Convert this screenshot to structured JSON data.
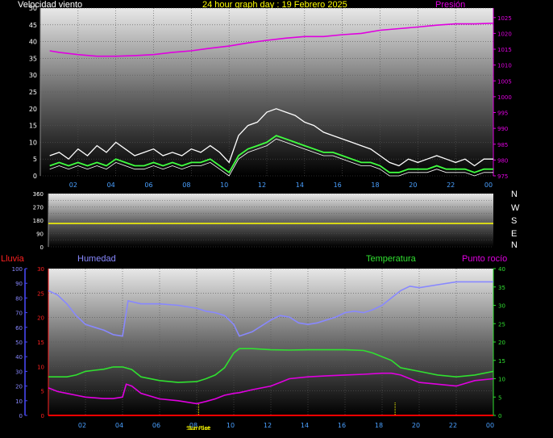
{
  "header": {
    "wind_title": "Velocidad viento",
    "graph_title": "24 hour graph day : 19 Febrero 2025",
    "pressure_title": "Presión"
  },
  "compass": [
    "N",
    "W",
    "S",
    "E",
    "N"
  ],
  "labels_bottom": {
    "rain": "Lluvia",
    "humidity": "Humedad",
    "temperature": "Temperatura",
    "dewpoint": "Punto rocío",
    "sunrise": "Sun Rise",
    "sunset": "Sun Set"
  },
  "colors": {
    "wind_gust": "#ffffff",
    "wind_avg": "#40ff40",
    "wind_avg2": "#ffffff",
    "pressure": "#e000e0",
    "direction": "#ffff00",
    "humidity": "#8888ff",
    "temperature": "#30e030",
    "dewpoint": "#e000e0",
    "rain": "#ff0000",
    "sun_marker": "#ffff00"
  },
  "chart_data": [
    {
      "type": "line",
      "name": "wind-pressure",
      "x_ticks": [
        "02",
        "04",
        "06",
        "08",
        "10",
        "12",
        "14",
        "16",
        "18",
        "20",
        "22",
        "00"
      ],
      "x_tick_hours": [
        2,
        4,
        6,
        8,
        10,
        12,
        14,
        16,
        18,
        20,
        22,
        24
      ],
      "ylim_left": [
        0,
        50
      ],
      "y_ticks_left": [
        0,
        5,
        10,
        15,
        20,
        25,
        30,
        35,
        40,
        45,
        50
      ],
      "ylim_right": [
        975,
        1028
      ],
      "y_ticks_right": [
        975,
        980,
        985,
        990,
        995,
        1000,
        1005,
        1010,
        1015,
        1020,
        1025
      ],
      "series": [
        {
          "key": "pressure",
          "axis": "right",
          "x": [
            0.5,
            1,
            2,
            3,
            4,
            5,
            6,
            7,
            8,
            9,
            10,
            11,
            12,
            13,
            14,
            15,
            16,
            17,
            18,
            19,
            20,
            21,
            22,
            23,
            24
          ],
          "values": [
            1014.5,
            1014,
            1013.3,
            1012.8,
            1012.8,
            1013,
            1013.3,
            1014,
            1014.5,
            1015.3,
            1016,
            1017,
            1017.8,
            1018.5,
            1019,
            1019,
            1019.6,
            1020,
            1021,
            1021.5,
            1022,
            1022.6,
            1023,
            1023,
            1023.2
          ]
        },
        {
          "key": "wind_gust",
          "axis": "left",
          "x": [
            0.5,
            1,
            1.5,
            2,
            2.5,
            3,
            3.5,
            4,
            4.5,
            5,
            5.5,
            6,
            6.5,
            7,
            7.5,
            8,
            8.5,
            9,
            9.5,
            10,
            10.5,
            11,
            11.5,
            12,
            12.5,
            13,
            13.5,
            14,
            14.5,
            15,
            15.5,
            16,
            16.5,
            17,
            17.5,
            18,
            18.5,
            19,
            19.5,
            20,
            20.5,
            21,
            21.5,
            22,
            22.5,
            23,
            23.5,
            24
          ],
          "values": [
            6,
            7,
            5,
            8,
            6,
            9,
            7,
            10,
            8,
            6,
            7,
            8,
            6,
            7,
            6,
            8,
            7,
            9,
            7,
            4,
            12,
            15,
            16,
            19,
            20,
            19,
            18,
            16,
            15,
            13,
            12,
            11,
            10,
            9,
            8,
            6,
            4,
            3,
            5,
            4,
            5,
            6,
            5,
            4,
            5,
            3,
            5,
            5
          ]
        },
        {
          "key": "wind_avg",
          "axis": "left",
          "x": [
            0.5,
            1,
            1.5,
            2,
            2.5,
            3,
            3.5,
            4,
            4.5,
            5,
            5.5,
            6,
            6.5,
            7,
            7.5,
            8,
            8.5,
            9,
            9.5,
            10,
            10.5,
            11,
            11.5,
            12,
            12.5,
            13,
            13.5,
            14,
            14.5,
            15,
            15.5,
            16,
            16.5,
            17,
            17.5,
            18,
            18.5,
            19,
            19.5,
            20,
            20.5,
            21,
            21.5,
            22,
            22.5,
            23,
            23.5,
            24
          ],
          "values": [
            3,
            4,
            3,
            4,
            3,
            4,
            3,
            5,
            4,
            3,
            3,
            4,
            3,
            4,
            3,
            4,
            4,
            5,
            3,
            1,
            6,
            8,
            9,
            10,
            12,
            11,
            10,
            9,
            8,
            7,
            7,
            6,
            5,
            4,
            4,
            3,
            1,
            1,
            2,
            2,
            2,
            3,
            2,
            2,
            2,
            1,
            2,
            2
          ]
        }
      ]
    },
    {
      "type": "line",
      "name": "wind-direction",
      "ylim": [
        0,
        360
      ],
      "y_ticks": [
        0,
        90,
        180,
        270,
        360
      ],
      "y_tick_labels": [
        "0",
        "90",
        "180",
        "270",
        "360"
      ],
      "extra_ticks": [
        45,
        135,
        225,
        315
      ],
      "series": [
        {
          "key": "direction",
          "x": [
            0,
            24
          ],
          "values": [
            158,
            158
          ]
        }
      ]
    },
    {
      "type": "line",
      "name": "humidity-temperature-dewpoint-rain",
      "x_ticks": [
        "02",
        "04",
        "06",
        "08",
        "10",
        "12",
        "14",
        "16",
        "18",
        "20",
        "22",
        "00"
      ],
      "x_tick_hours": [
        2,
        4,
        6,
        8,
        10,
        12,
        14,
        16,
        18,
        20,
        22,
        24
      ],
      "ylim_humidity": [
        0,
        100
      ],
      "y_ticks_humidity": [
        0,
        10,
        20,
        30,
        40,
        50,
        60,
        70,
        80,
        90,
        100
      ],
      "ylim_rain": [
        0,
        30
      ],
      "y_ticks_rain": [
        0,
        5,
        10,
        15,
        20,
        25,
        30
      ],
      "ylim_temp": [
        0,
        40
      ],
      "y_ticks_temp": [
        0,
        5,
        10,
        15,
        20,
        25,
        30,
        35,
        40
      ],
      "sun_markers": [
        8.1,
        18.7
      ],
      "series": [
        {
          "key": "humidity",
          "axis": "humidity",
          "x": [
            0,
            0.5,
            1,
            1.5,
            2,
            2.5,
            3,
            3.5,
            4,
            4.3,
            5,
            6,
            7,
            8,
            8.5,
            9,
            9.5,
            10,
            10.3,
            11,
            11.5,
            12,
            12.5,
            13,
            13.5,
            14,
            14.5,
            15,
            15.5,
            16,
            16.5,
            17,
            17.5,
            18,
            18.5,
            19,
            19.5,
            20,
            21,
            22,
            23,
            24
          ],
          "values": [
            85,
            82,
            76,
            68,
            62,
            60,
            58,
            55,
            54,
            78,
            76,
            76,
            75,
            73,
            71,
            70,
            68,
            62,
            54,
            57,
            61,
            65,
            68,
            67,
            63,
            62,
            63,
            65,
            67,
            70,
            71,
            70,
            72,
            75,
            80,
            85,
            88,
            87,
            89,
            91,
            91,
            91
          ]
        },
        {
          "key": "temperature",
          "axis": "temp",
          "x": [
            0,
            0.5,
            1,
            1.5,
            2,
            2.5,
            3,
            3.5,
            4,
            4.5,
            5,
            6,
            7,
            8,
            8.5,
            9,
            9.5,
            10,
            10.3,
            11,
            12,
            13,
            14,
            15,
            16,
            17,
            17.5,
            18,
            18.5,
            19,
            20,
            21,
            22,
            23,
            24
          ],
          "values": [
            10.5,
            10.5,
            10.5,
            11,
            12,
            12.3,
            12.6,
            13.2,
            13.2,
            12.5,
            10.5,
            9.5,
            9,
            9.2,
            10,
            11,
            13,
            17,
            18.2,
            18.2,
            17.9,
            17.8,
            17.9,
            17.9,
            17.9,
            17.7,
            17,
            16,
            15,
            13,
            12,
            11,
            10.5,
            11,
            12
          ]
        },
        {
          "key": "dewpoint",
          "axis": "temp",
          "x": [
            0,
            0.5,
            1,
            1.5,
            2,
            2.5,
            3,
            3.5,
            4,
            4.2,
            4.5,
            5,
            6,
            7,
            8,
            8.5,
            9,
            9.5,
            10,
            10.3,
            11,
            12,
            12.5,
            13,
            14,
            15,
            16,
            17,
            18,
            18.5,
            19,
            19.5,
            20,
            21,
            22,
            23,
            24
          ],
          "values": [
            7.5,
            6.5,
            6,
            5.5,
            5,
            4.8,
            4.6,
            4.6,
            5,
            8.5,
            8,
            6,
            4.5,
            4,
            3.2,
            3.8,
            4.5,
            5.5,
            6,
            6.2,
            7,
            8,
            9,
            10,
            10.5,
            10.8,
            11,
            11.2,
            11.5,
            11.5,
            11,
            10,
            9,
            8.5,
            8,
            9.5,
            10
          ]
        },
        {
          "key": "rain",
          "axis": "rain",
          "x": [
            0,
            24
          ],
          "values": [
            0,
            0
          ]
        }
      ]
    }
  ]
}
